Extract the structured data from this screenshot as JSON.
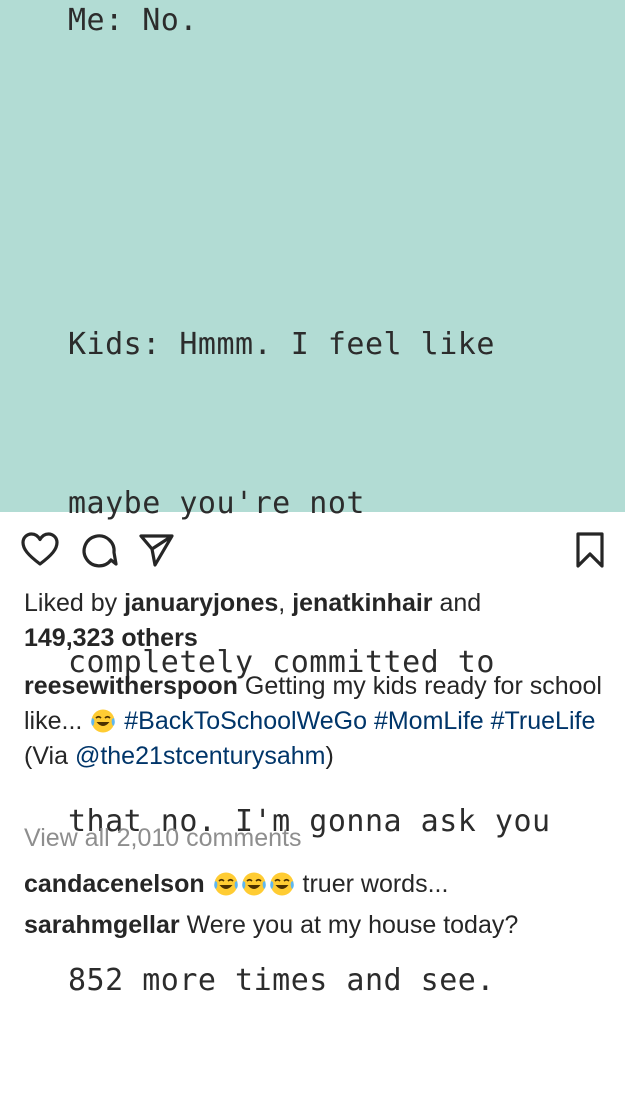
{
  "post": {
    "image": {
      "background": "#b2dcd4",
      "line_top": "Me: No.",
      "body_lines": [
        "Kids: Hmmm. I feel like",
        "maybe you're not",
        "completely committed to",
        "that no. I'm gonna ask you",
        "852 more times and see."
      ]
    },
    "actions": {
      "like_icon": "heart-icon",
      "comment_icon": "comment-icon",
      "share_icon": "share-icon",
      "save_icon": "bookmark-icon"
    },
    "likes": {
      "prefix": "Liked by ",
      "user1": "januaryjones",
      "sep": ", ",
      "user2": "jenatkinhair",
      "and": " and",
      "count": "149,323 others"
    },
    "caption": {
      "username": "reesewitherspoon",
      "text": " Getting my kids ready for school like... ",
      "emoji": "tears-of-joy-emoji",
      "hashtag1": "#BackToSchoolWeGo",
      "hashtag2": "#MomLife",
      "hashtag3": "#TrueLife",
      "via": " (Via ",
      "mention": "@the21stcenturysahm",
      "close": ")"
    },
    "view_all_comments": "View all 2,010 comments",
    "comments": [
      {
        "username": "candacenelson",
        "emoji_count": 3,
        "text": " truer words..."
      },
      {
        "username": "sarahmgellar",
        "text": " Were you at my house today?"
      }
    ],
    "colors": {
      "text": "#262626",
      "link": "#003569",
      "muted": "#8e8e8e"
    }
  }
}
